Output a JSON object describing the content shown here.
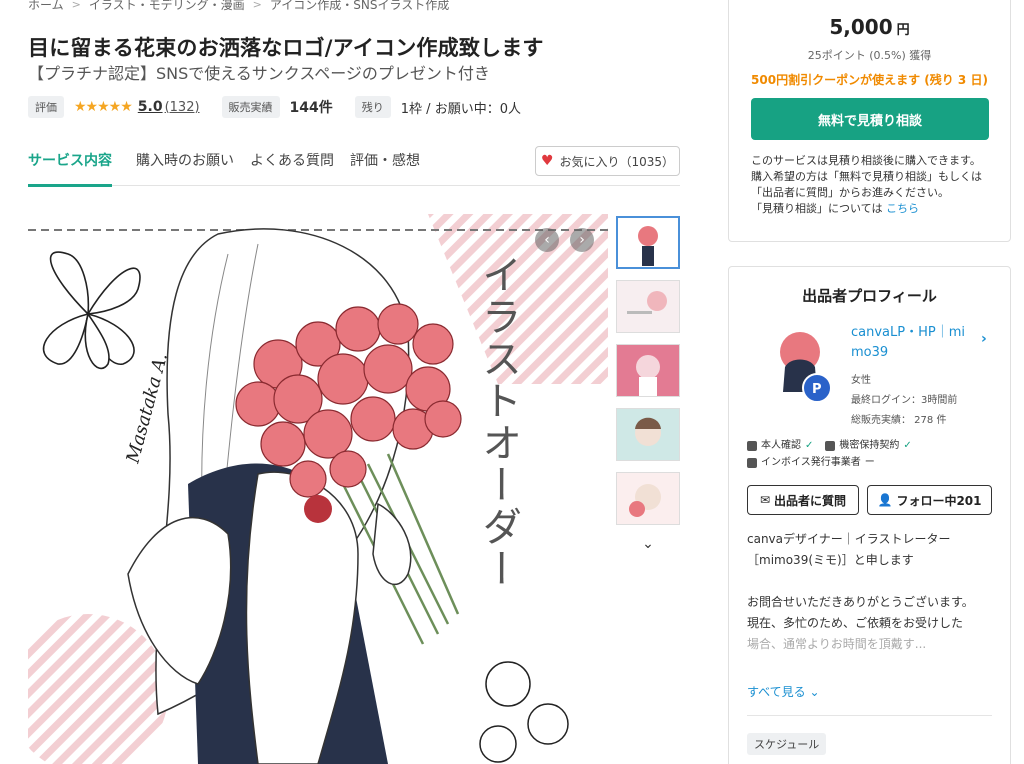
{
  "breadcrumb": [
    "ホーム",
    "イラスト・モデリング・漫画",
    "アイコン作成・SNSイラスト作成"
  ],
  "service": {
    "title": "目に留まる花束のお洒落なロゴ/アイコン作成致します",
    "subtitle": "【プラチナ認定】SNSで使えるサンクスページのプレゼント付き"
  },
  "stats": {
    "rating_label": "評価",
    "stars": "★★★★★",
    "rating": "5.0",
    "rating_count": "(132)",
    "sales_label": "販売実績",
    "sales": "144件",
    "remaining_label": "残り",
    "remaining": "1枠 / お願い中：0人"
  },
  "tabs": [
    "サービス内容",
    "購入時のお願い",
    "よくある質問",
    "評価・感想"
  ],
  "favorite": {
    "label": "お気に入り（1035）"
  },
  "image_text": {
    "vertical": "イラストオーダー",
    "signature": "Masataka A."
  },
  "price_card": {
    "price": "5,000",
    "currency": "円",
    "points": "25ポイント (0.5%) 獲得",
    "coupon": "500円割引クーポンが使えます (残り 3 日)",
    "cta": "無料で見積り相談",
    "note_lines": [
      "このサービスは見積り相談後に購入できます。",
      "購入希望の方は「無料で見積り相談」もしくは",
      "「出品者に質問」からお進みください。"
    ],
    "note_last": "「見積り相談」については",
    "note_link": "こちら"
  },
  "profile": {
    "title": "出品者プロフィール",
    "name_line1": "canvaLP・HP｜mi",
    "name_line2": "mo39",
    "gender": "女性",
    "last_login": "最終ログイン：3時間前",
    "total_sales": "総販売実績： 278 件",
    "badge_verified": "本人確認",
    "badge_nda": "機密保持契約",
    "badge_invoice": "インボイス発行事業者",
    "badge_invoice_value": "ー",
    "ask_button": "出品者に質問",
    "follow_button": "フォロー中201",
    "bio": [
      "canvaデザイナー｜イラストレーター",
      "［mimo39(ミモ)］と申します"
    ],
    "bio2": [
      "お問合せいただきありがとうございます。",
      "現在、多忙のため、ご依頼をお受けした",
      "場合、通常よりお時間を頂戴す..."
    ],
    "see_all": "すべて見る",
    "schedule": "スケジュール"
  },
  "colors": {
    "accent": "#17a283",
    "link": "#1a8fd1",
    "coupon": "#f08a00",
    "heart": "#e0393e",
    "star": "#f5a623"
  }
}
